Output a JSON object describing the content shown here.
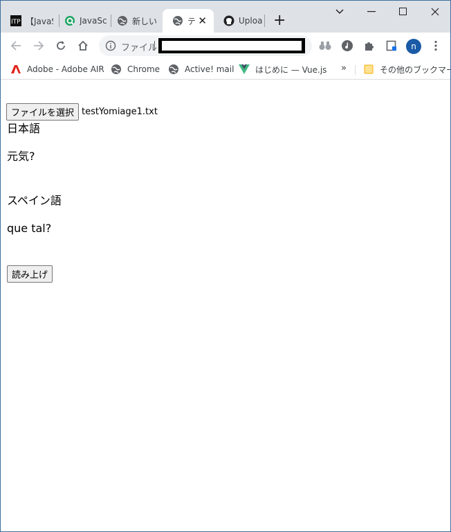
{
  "browser": {
    "tabs": [
      {
        "label": "【JavaS",
        "icon": "itp-icon"
      },
      {
        "label": "JavaSc",
        "icon": "search-q-icon"
      },
      {
        "label": "新しい",
        "icon": "globe-icon"
      },
      {
        "label": "テ",
        "icon": "globe-icon",
        "active": true
      },
      {
        "label": "Uploa",
        "icon": "github-icon"
      }
    ],
    "new_tab": "+",
    "address": {
      "label": "ファイル"
    },
    "profile_initial": "n"
  },
  "bookmarks": {
    "items": [
      {
        "label": "Adobe - Adobe AIR",
        "icon": "adobe-icon"
      },
      {
        "label": "Chrome",
        "icon": "globe-icon"
      },
      {
        "label": "Active! mail",
        "icon": "globe-icon"
      },
      {
        "label": "はじめに — Vue.js",
        "icon": "vue-icon"
      }
    ],
    "more": "»",
    "other_folder": "その他のブックマーク"
  },
  "page": {
    "file_button": "ファイルを選択",
    "file_name": "testYomiage1.txt",
    "japanese_label": "日本語",
    "japanese_text": "元気?",
    "spanish_label": "スペイン語",
    "spanish_text": "que tal?",
    "read_button": "読み上げ"
  },
  "colors": {
    "tabstrip": "#dee1e6",
    "avatar": "#1a5aa6",
    "accent_green": "#1ea362"
  }
}
